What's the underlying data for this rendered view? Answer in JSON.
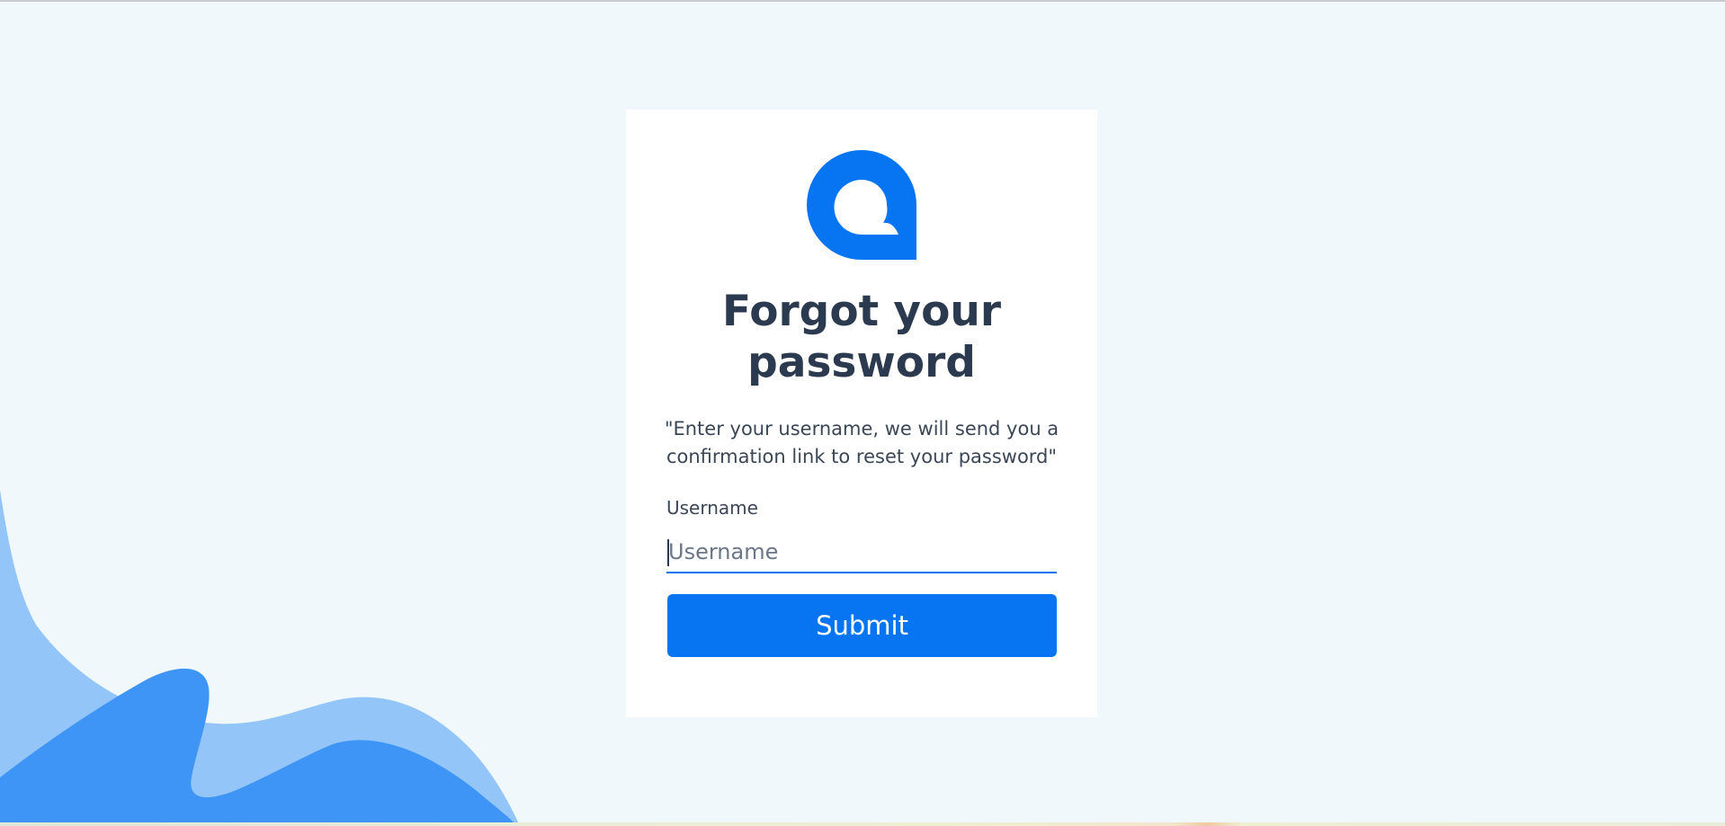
{
  "page": {
    "title_line1": "Forgot your",
    "title_line2": "password",
    "description_line1": "\"Enter your username, we will send you a",
    "description_line2": "confirmation link to reset your password\""
  },
  "form": {
    "username_label": "Username",
    "username_placeholder": "Username",
    "username_value": "",
    "submit_label": "Submit"
  },
  "icons": {
    "logo": "brand-q-logo-icon",
    "background": "decorative-waves"
  },
  "colors": {
    "accent": "#0775f2",
    "background": "#f0f8fc",
    "card": "#ffffff",
    "text": "#2b3a4e",
    "wave_light": "#93c5f8",
    "wave_dark": "#3f95f5"
  }
}
